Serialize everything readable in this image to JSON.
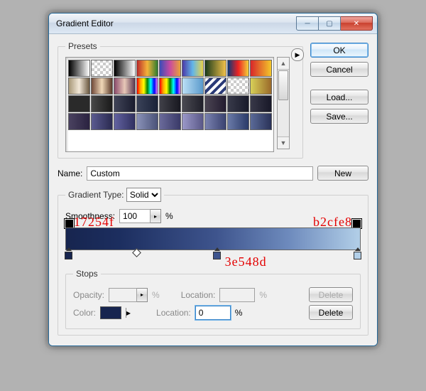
{
  "window": {
    "title": "Gradient Editor"
  },
  "buttons": {
    "ok": "OK",
    "cancel": "Cancel",
    "load": "Load...",
    "save": "Save...",
    "new": "New",
    "delete": "Delete"
  },
  "presets": {
    "legend": "Presets"
  },
  "name": {
    "label": "Name:",
    "value": "Custom"
  },
  "grad": {
    "type_label": "Gradient Type:",
    "type_value": "Solid",
    "smooth_label": "Smoothness:",
    "smooth_value": "100",
    "percent": "%"
  },
  "annotations": {
    "left": "17254f",
    "mid": "3e548d",
    "right": "b2cfe8"
  },
  "stops": {
    "legend": "Stops",
    "opacity_label": "Opacity:",
    "opacity_val": "",
    "loc1_label": "Location:",
    "loc1_val": "",
    "color_label": "Color:",
    "color_val": "#17254f",
    "loc2_label": "Location:",
    "loc2_val": "0"
  },
  "preset_colors": [
    "linear-gradient(90deg,#000,#fff)",
    "repeating-conic-gradient(#ccc 0 25%,#fff 0 50%) 0/8px 8px,linear-gradient(90deg,#000,transparent)",
    "linear-gradient(90deg,#000,#fff)",
    "linear-gradient(90deg,#bb2a2a,#f4b33a,#2f7d2f)",
    "linear-gradient(90deg,#3a4db8,#c94aa0,#e8a23a)",
    "linear-gradient(90deg,#4b3aa8,#63b6e8,#e8d24a)",
    "linear-gradient(90deg,#1a3a1a,#f2c24a)",
    "linear-gradient(90deg,#0a3a78,#e22,#f2d23a)",
    "linear-gradient(90deg,#d8262a,#f3c72a)",
    "linear-gradient(90deg,#a89878,#f2e8d8,#6a5840)",
    "linear-gradient(90deg,#704838,#f0d8b8,#5a3828)",
    "linear-gradient(90deg,#8a4a6a,#e8c8b8,#5a3850)",
    "linear-gradient(90deg,red,orange,yellow,green,cyan,blue,violet)",
    "linear-gradient(90deg,red,orange,yellow,green,cyan,blue,violet)",
    "linear-gradient(90deg,#bbdff5,#5a9acc)",
    "repeating-linear-gradient(135deg,#fff 0 4px,#2a3a78 4px 8px)",
    "repeating-conic-gradient(#ccc 0 25%,#fff 0 50%) 0/8px 8px",
    "linear-gradient(90deg,#d8d058,#9a6a2a)",
    "#2a2a2a",
    "linear-gradient(90deg,#484848,#1a1a1a)",
    "linear-gradient(90deg,#404458,#1a1c2e)",
    "linear-gradient(90deg,#3a4258,#1a2238)",
    "linear-gradient(90deg,#404048,#181820)",
    "linear-gradient(90deg,#4a4a52,#20202a)",
    "linear-gradient(90deg,#4a4452,#241c30)",
    "linear-gradient(90deg,#383a4a,#181a2a)",
    "linear-gradient(90deg,#383848,#181828)",
    "linear-gradient(90deg,#4a4260,#2a2240)",
    "linear-gradient(90deg,#5a5a90,#2a2a50)",
    "linear-gradient(90deg,#6262a0,#303060)",
    "linear-gradient(90deg,#8a92b8,#4a5278)",
    "linear-gradient(90deg,#6a6a9a,#3a3a68)",
    "linear-gradient(90deg,#9a98c8,#5a5888)",
    "linear-gradient(90deg,#7a82b0,#3a4270)",
    "linear-gradient(90deg,#6a7aa8,#2a3a68)",
    "linear-gradient(90deg,#5a6a98,#2a3258)"
  ]
}
